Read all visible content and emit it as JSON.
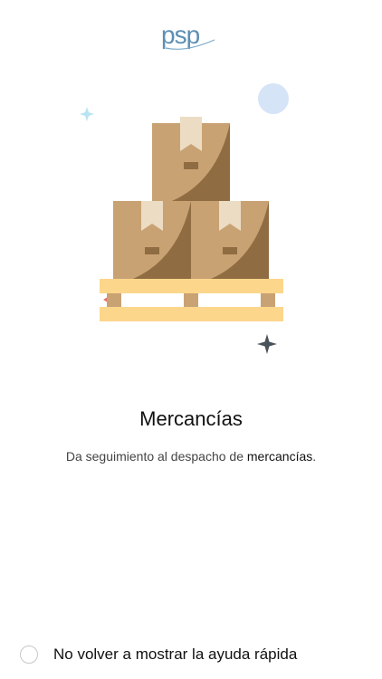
{
  "header": {
    "logo_text": "psp"
  },
  "illustration": {
    "name": "boxes-on-pallet",
    "colors": {
      "box": "#c9a273",
      "box_shade": "#8f6c42",
      "tape": "#ecdcc4",
      "pallet": "#fcd68b",
      "pallet_legs": "#c9a273",
      "bubble": "#d6e4f7",
      "sparkle_light": "#b9e4f3",
      "sparkle_dark": "#4a525a"
    }
  },
  "content": {
    "title": "Mercancías",
    "subtitle_prefix": "Da seguimiento al despacho de ",
    "subtitle_emphasis": "mercancías",
    "subtitle_suffix": "."
  },
  "footer": {
    "option_label": "No volver a mostrar la ayuda rápida",
    "option_checked": false
  }
}
